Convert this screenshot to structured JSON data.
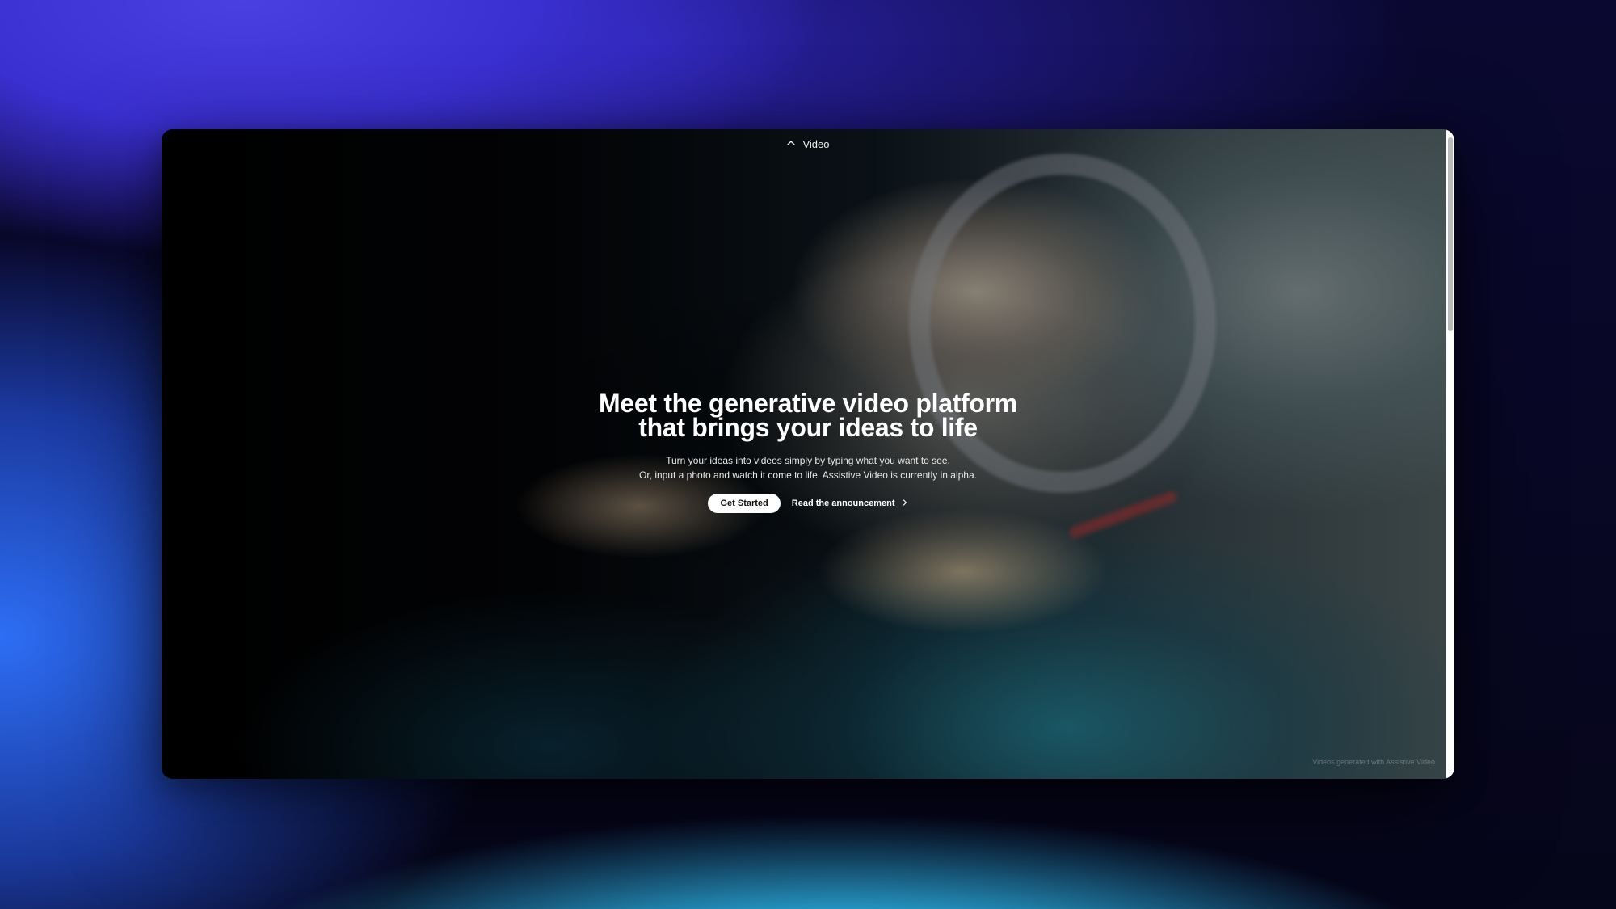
{
  "header": {
    "badge_label": "Video",
    "badge_icon": "chevron-up-icon"
  },
  "hero": {
    "title_line1": "Meet the generative video platform",
    "title_line2": "that brings your ideas to life",
    "subtitle_line1": "Turn your ideas into videos simply by typing what you want to see.",
    "subtitle_line2": "Or, input a photo and watch it come to life. Assistive Video is currently in alpha.",
    "primary_button": "Get Started",
    "secondary_link": "Read the announcement",
    "secondary_icon": "chevron-right-icon"
  },
  "footer": {
    "credit": "Videos generated with Assistive Video"
  },
  "colors": {
    "button_bg": "#ffffff",
    "text_primary": "#ffffff"
  }
}
